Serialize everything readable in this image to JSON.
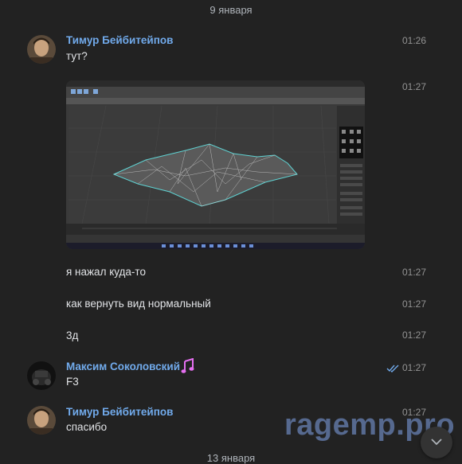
{
  "dates": {
    "first": "9 января",
    "second": "13 января"
  },
  "messages": [
    {
      "author": "Тимур Бейбитейпов",
      "text": "тут?",
      "time": "01:26"
    },
    {
      "text": "",
      "time": "01:27",
      "attachment": "photo"
    },
    {
      "text": "я нажал куда-то",
      "time": "01:27"
    },
    {
      "text": "как вернуть вид нормальный",
      "time": "01:27"
    },
    {
      "text": "3д",
      "time": "01:27"
    },
    {
      "author": "Максим Соколовский",
      "author_badge": "music-note-icon",
      "text": "F3",
      "time": "01:27",
      "status": "read"
    },
    {
      "author": "Тимур Бейбитейпов",
      "text": "спасибо",
      "time": "01:27"
    }
  ],
  "watermark": "ragemp.pro",
  "colors": {
    "background": "#222222",
    "author_name": "#71aaeb",
    "message_text": "#e1e3e6",
    "time": "#939393",
    "read_ticks": "#71aaeb",
    "badge": "#e56ff0",
    "watermark": "#56698f"
  }
}
